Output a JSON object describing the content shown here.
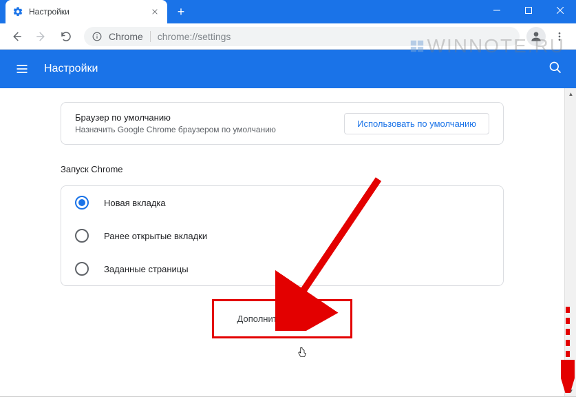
{
  "tab": {
    "title": "Настройки"
  },
  "omnibox": {
    "chrome_label": "Chrome",
    "url": "chrome://settings"
  },
  "header": {
    "title": "Настройки"
  },
  "default_browser": {
    "title": "Браузер по умолчанию",
    "subtitle": "Назначить Google Chrome браузером по умолчанию",
    "button": "Использовать по умолчанию"
  },
  "startup": {
    "title": "Запуск Chrome",
    "options": [
      {
        "label": "Новая вкладка",
        "checked": true
      },
      {
        "label": "Ранее открытые вкладки",
        "checked": false
      },
      {
        "label": "Заданные страницы",
        "checked": false
      }
    ]
  },
  "advanced": {
    "label": "Дополнительные"
  },
  "watermark": {
    "text": "WINNOTE.RU"
  }
}
